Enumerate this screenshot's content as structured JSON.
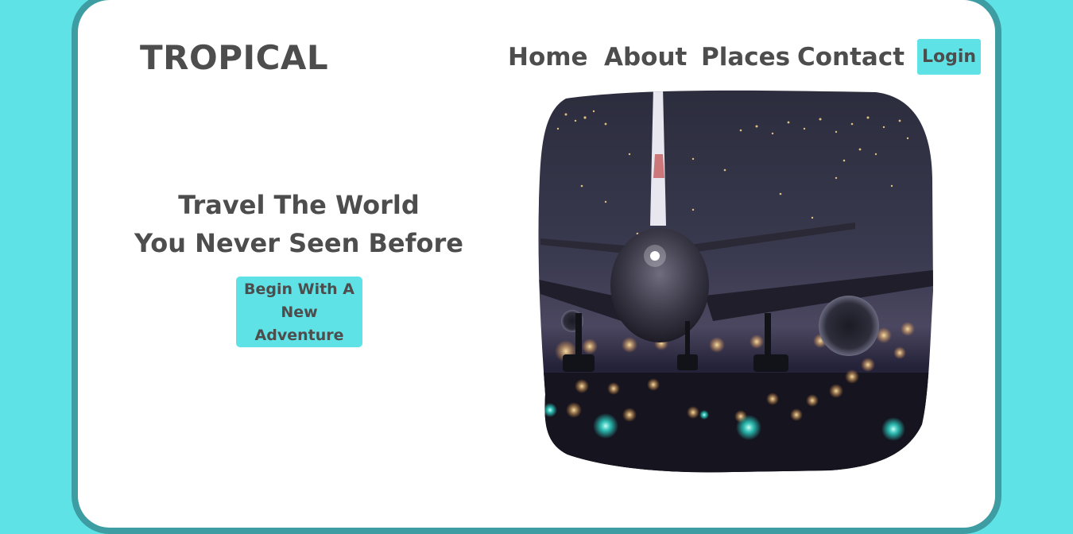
{
  "header": {
    "logo_text": "TROPICAL",
    "nav": {
      "home": "Home",
      "about": "About",
      "places": "Places",
      "contact": "Contact"
    },
    "login_label": "Login"
  },
  "hero": {
    "title_line1": "Travel The World",
    "title_line2": "You Never Seen Before",
    "cta_label": "Begin With A New Adventure"
  },
  "image": {
    "subject": "airplane-on-runway-at-night"
  },
  "colors": {
    "background": "#5ee2e6",
    "card_border": "#3d9da2",
    "accent": "#5ee2e6",
    "text": "#4d4d4d"
  }
}
